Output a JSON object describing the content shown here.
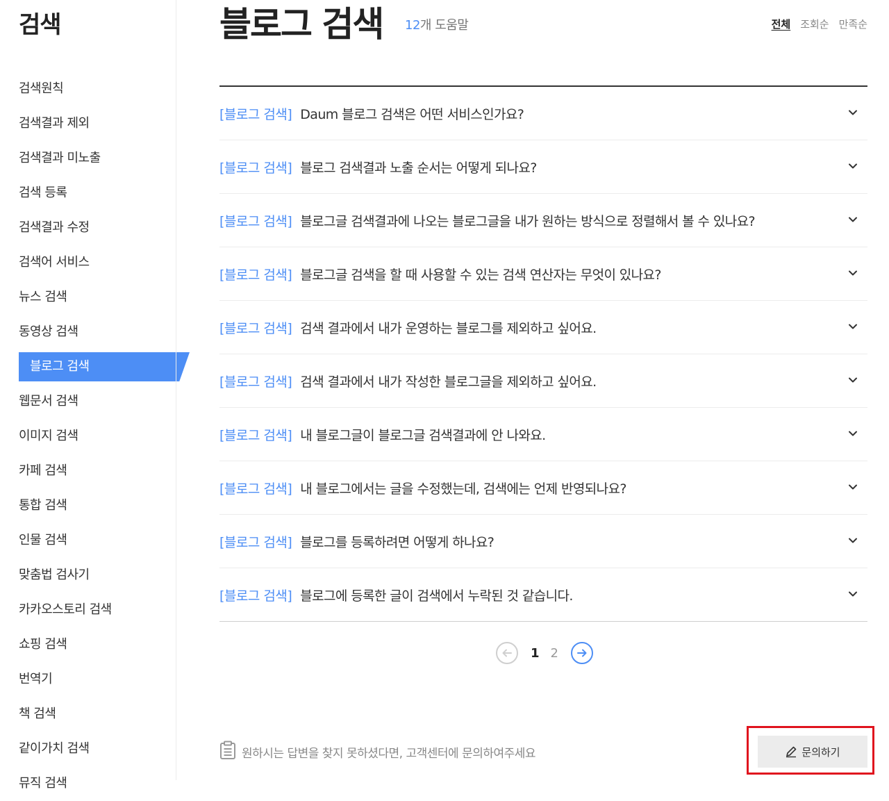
{
  "sidebar": {
    "title": "검색",
    "items": [
      {
        "label": "검색원칙",
        "active": false
      },
      {
        "label": "검색결과 제외",
        "active": false
      },
      {
        "label": "검색결과 미노출",
        "active": false
      },
      {
        "label": "검색 등록",
        "active": false
      },
      {
        "label": "검색결과 수정",
        "active": false
      },
      {
        "label": "검색어 서비스",
        "active": false
      },
      {
        "label": "뉴스 검색",
        "active": false
      },
      {
        "label": "동영상 검색",
        "active": false
      },
      {
        "label": "블로그 검색",
        "active": true
      },
      {
        "label": "웹문서 검색",
        "active": false
      },
      {
        "label": "이미지 검색",
        "active": false
      },
      {
        "label": "카페 검색",
        "active": false
      },
      {
        "label": "통합 검색",
        "active": false
      },
      {
        "label": "인물 검색",
        "active": false
      },
      {
        "label": "맞춤법 검사기",
        "active": false
      },
      {
        "label": "카카오스토리 검색",
        "active": false
      },
      {
        "label": "쇼핑 검색",
        "active": false
      },
      {
        "label": "번역기",
        "active": false
      },
      {
        "label": "책 검색",
        "active": false
      },
      {
        "label": "같이가치 검색",
        "active": false
      },
      {
        "label": "뮤직 검색",
        "active": false
      }
    ]
  },
  "header": {
    "title": "블로그 검색",
    "count_number": "12",
    "count_suffix": "개 도움말",
    "sort_tabs": [
      {
        "label": "전체",
        "active": true
      },
      {
        "label": "조회순",
        "active": false
      },
      {
        "label": "만족순",
        "active": false
      }
    ]
  },
  "faq": {
    "items": [
      {
        "tag": "[블로그 검색]",
        "question": "Daum 블로그 검색은 어떤 서비스인가요?"
      },
      {
        "tag": "[블로그 검색]",
        "question": "블로그 검색결과 노출 순서는 어떻게 되나요?"
      },
      {
        "tag": "[블로그 검색]",
        "question": "블로그글 검색결과에 나오는 블로그글을 내가 원하는 방식으로 정렬해서 볼 수 있나요?"
      },
      {
        "tag": "[블로그 검색]",
        "question": "블로그글 검색을 할 때 사용할 수 있는 검색 연산자는 무엇이 있나요?"
      },
      {
        "tag": "[블로그 검색]",
        "question": "검색 결과에서 내가 운영하는 블로그를 제외하고 싶어요."
      },
      {
        "tag": "[블로그 검색]",
        "question": "검색 결과에서 내가 작성한 블로그글을 제외하고 싶어요."
      },
      {
        "tag": "[블로그 검색]",
        "question": "내 블로그글이 블로그글 검색결과에 안 나와요."
      },
      {
        "tag": "[블로그 검색]",
        "question": "내 블로그에서는 글을 수정했는데, 검색에는 언제 반영되나요?"
      },
      {
        "tag": "[블로그 검색]",
        "question": "블로그를 등록하려면 어떻게 하나요?"
      },
      {
        "tag": "[블로그 검색]",
        "question": "블로그에 등록한 글이 검색에서 누락된 것 같습니다."
      }
    ]
  },
  "pagination": {
    "current": "1",
    "other": "2"
  },
  "footer": {
    "note": "원하시는 답변을 찾지 못하셨다면, 고객센터에 문의하여주세요",
    "inquiry_label": "문의하기"
  },
  "colors": {
    "accent": "#4d8ef5",
    "highlight_border": "#e0141e"
  },
  "icons": [
    "chevron-down-icon",
    "arrow-left-icon",
    "arrow-right-icon",
    "clipboard-icon",
    "pencil-icon"
  ]
}
